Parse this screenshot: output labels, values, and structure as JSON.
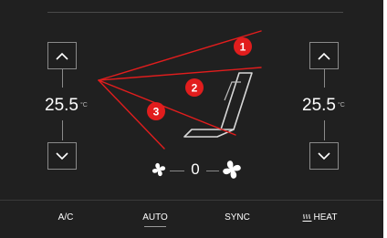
{
  "left_zone": {
    "temperature": "25.5",
    "unit": "°C"
  },
  "right_zone": {
    "temperature": "25.5",
    "unit": "°C"
  },
  "fan": {
    "speed": "0"
  },
  "bottom_bar": {
    "items": [
      {
        "label": "A/C"
      },
      {
        "label": "AUTO"
      },
      {
        "label": "SYNC"
      },
      {
        "label": "HEAT",
        "icon": "seat-heat-icon"
      }
    ]
  },
  "annotations": {
    "callouts": [
      "1",
      "2",
      "3"
    ],
    "color": "#e11d1d"
  },
  "colors": {
    "background": "#202020",
    "text": "#ffffff",
    "outline": "#8a8a8a",
    "annotation": "#e11d1d"
  }
}
